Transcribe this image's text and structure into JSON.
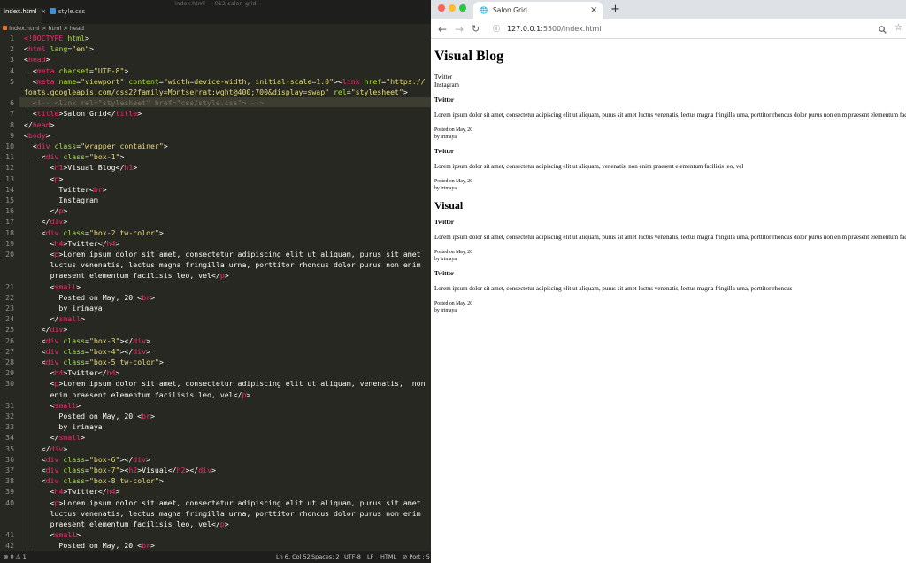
{
  "window_title": "index.html — 012-salon-grid",
  "editor": {
    "tabs": [
      {
        "label": "index.html",
        "close": "×"
      },
      {
        "label": "style.css"
      }
    ],
    "breadcrumb": {
      "file": "index.html",
      "sep": ">",
      "html": "html",
      "head": "head"
    },
    "lines": [
      {
        "n": "1",
        "h": "<span class=\"t\">&lt;!DOCTYPE</span> <span class=\"a\">html</span>&gt;"
      },
      {
        "n": "2",
        "h": "&lt;<span class=\"t\">html</span> <span class=\"a\">lang</span>=<span class=\"s\">\"en\"</span>&gt;"
      },
      {
        "n": "3",
        "h": "&lt;<span class=\"t\">head</span>&gt;"
      },
      {
        "n": "4",
        "h": "  &lt;<span class=\"t\">meta</span> <span class=\"a\">charset</span>=<span class=\"s\">\"UTF-8\"</span>&gt;"
      },
      {
        "n": "5",
        "h": "  &lt;<span class=\"t\">meta</span> <span class=\"a\">name</span>=<span class=\"s\">\"viewport\"</span> <span class=\"a\">content</span>=<span class=\"s\">\"width=device-width, initial-scale=1.0\"</span>&gt;&lt;<span class=\"t\">link</span> <span class=\"a\">href</span>=<span class=\"s\">\"https://</span>"
      },
      {
        "n": "",
        "h": "<span class=\"s\">fonts.googleapis.com/css2?family=Montserrat:wght@400;700&amp;display=swap\"</span> <span class=\"a\">rel</span>=<span class=\"s\">\"stylesheet\"</span>&gt;"
      },
      {
        "n": "6",
        "h": "  <span class=\"c\">&lt;!-- &lt;link rel=\"stylesheet\" href=\"css/style.css\"&gt; --&gt;</span>",
        "cur": true
      },
      {
        "n": "7",
        "h": "  &lt;<span class=\"t\">title</span>&gt;Salon Grid&lt;/<span class=\"t\">title</span>&gt;"
      },
      {
        "n": "8",
        "h": "&lt;/<span class=\"t\">head</span>&gt;"
      },
      {
        "n": "9",
        "h": "&lt;<span class=\"t\">body</span>&gt;"
      },
      {
        "n": "10",
        "h": "  &lt;<span class=\"t\">div</span> <span class=\"a\">class</span>=<span class=\"s\">\"wrapper container\"</span>&gt;"
      },
      {
        "n": "11",
        "h": "    &lt;<span class=\"t\">div</span> <span class=\"a\">class</span>=<span class=\"s\">\"box-1\"</span>&gt;"
      },
      {
        "n": "12",
        "h": "      &lt;<span class=\"t\">h1</span>&gt;Visual Blog&lt;/<span class=\"t\">h1</span>&gt;"
      },
      {
        "n": "13",
        "h": "      &lt;<span class=\"t\">p</span>&gt;"
      },
      {
        "n": "14",
        "h": "        Twitter&lt;<span class=\"t\">br</span>&gt;"
      },
      {
        "n": "15",
        "h": "        Instagram"
      },
      {
        "n": "16",
        "h": "      &lt;/<span class=\"t\">p</span>&gt;"
      },
      {
        "n": "17",
        "h": "    &lt;/<span class=\"t\">div</span>&gt;"
      },
      {
        "n": "18",
        "h": "    &lt;<span class=\"t\">div</span> <span class=\"a\">class</span>=<span class=\"s\">\"box-2 tw-color\"</span>&gt;"
      },
      {
        "n": "19",
        "h": "      &lt;<span class=\"t\">h4</span>&gt;Twitter&lt;/<span class=\"t\">h4</span>&gt;"
      },
      {
        "n": "20",
        "h": "      &lt;<span class=\"t\">p</span>&gt;Lorem ipsum dolor sit amet, consectetur adipiscing elit ut aliquam, purus sit amet"
      },
      {
        "n": "",
        "h": "      luctus venenatis, lectus magna fringilla urna, porttitor rhoncus dolor purus non enim"
      },
      {
        "n": "",
        "h": "      praesent elementum facilisis leo, vel&lt;/<span class=\"t\">p</span>&gt;"
      },
      {
        "n": "21",
        "h": "      &lt;<span class=\"t\">small</span>&gt;"
      },
      {
        "n": "22",
        "h": "        Posted on May, 20 &lt;<span class=\"t\">br</span>&gt;"
      },
      {
        "n": "23",
        "h": "        by irimaya"
      },
      {
        "n": "24",
        "h": "      &lt;/<span class=\"t\">small</span>&gt;"
      },
      {
        "n": "25",
        "h": "    &lt;/<span class=\"t\">div</span>&gt;"
      },
      {
        "n": "26",
        "h": "    &lt;<span class=\"t\">div</span> <span class=\"a\">class</span>=<span class=\"s\">\"box-3\"</span>&gt;&lt;/<span class=\"t\">div</span>&gt;"
      },
      {
        "n": "27",
        "h": "    &lt;<span class=\"t\">div</span> <span class=\"a\">class</span>=<span class=\"s\">\"box-4\"</span>&gt;&lt;/<span class=\"t\">div</span>&gt;"
      },
      {
        "n": "28",
        "h": "    &lt;<span class=\"t\">div</span> <span class=\"a\">class</span>=<span class=\"s\">\"box-5 tw-color\"</span>&gt;"
      },
      {
        "n": "29",
        "h": "      &lt;<span class=\"t\">h4</span>&gt;Twitter&lt;/<span class=\"t\">h4</span>&gt;"
      },
      {
        "n": "30",
        "h": "      &lt;<span class=\"t\">p</span>&gt;Lorem ipsum dolor sit amet, consectetur adipiscing elit ut aliquam, venenatis,  non"
      },
      {
        "n": "",
        "h": "      enim praesent elementum facilisis leo, vel&lt;/<span class=\"t\">p</span>&gt;"
      },
      {
        "n": "31",
        "h": "      &lt;<span class=\"t\">small</span>&gt;"
      },
      {
        "n": "32",
        "h": "        Posted on May, 20 &lt;<span class=\"t\">br</span>&gt;"
      },
      {
        "n": "33",
        "h": "        by irimaya"
      },
      {
        "n": "34",
        "h": "      &lt;/<span class=\"t\">small</span>&gt;"
      },
      {
        "n": "35",
        "h": "    &lt;/<span class=\"t\">div</span>&gt;"
      },
      {
        "n": "36",
        "h": "    &lt;<span class=\"t\">div</span> <span class=\"a\">class</span>=<span class=\"s\">\"box-6\"</span>&gt;&lt;/<span class=\"t\">div</span>&gt;"
      },
      {
        "n": "37",
        "h": "    &lt;<span class=\"t\">div</span> <span class=\"a\">class</span>=<span class=\"s\">\"box-7\"</span>&gt;&lt;<span class=\"t\">h2</span>&gt;Visual&lt;/<span class=\"t\">h2</span>&gt;&lt;/<span class=\"t\">div</span>&gt;"
      },
      {
        "n": "38",
        "h": "    &lt;<span class=\"t\">div</span> <span class=\"a\">class</span>=<span class=\"s\">\"box-8 tw-color\"</span>&gt;"
      },
      {
        "n": "39",
        "h": "      &lt;<span class=\"t\">h4</span>&gt;Twitter&lt;/<span class=\"t\">h4</span>&gt;"
      },
      {
        "n": "40",
        "h": "      &lt;<span class=\"t\">p</span>&gt;Lorem ipsum dolor sit amet, consectetur adipiscing elit ut aliquam, purus sit amet"
      },
      {
        "n": "",
        "h": "      luctus venenatis, lectus magna fringilla urna, porttitor rhoncus dolor purus non enim"
      },
      {
        "n": "",
        "h": "      praesent elementum facilisis leo, vel&lt;/<span class=\"t\">p</span>&gt;"
      },
      {
        "n": "41",
        "h": "      &lt;<span class=\"t\">small</span>&gt;"
      },
      {
        "n": "42",
        "h": "        Posted on May, 20 &lt;<span class=\"t\">br</span>&gt;"
      }
    ],
    "status": {
      "problems": "⊗ 0 ⚠ 1",
      "position": "Ln 6, Col 52",
      "spaces": "Spaces: 2",
      "encoding": "UTF-8",
      "eol": "LF",
      "language": "HTML",
      "port": "⊘ Port : 5"
    }
  },
  "browser": {
    "tab_title": "Salon Grid",
    "tab_close": "×",
    "new_tab": "+",
    "url_host": "127.0.0.1",
    "url_rest": ":5500/index.html",
    "page": {
      "h1": "Visual Blog",
      "social_1": "Twitter",
      "social_2": "Instagram",
      "h2": "Visual",
      "posts": [
        {
          "h4": "Twitter",
          "p": "Lorem ipsum dolor sit amet, consectetur adipiscing elit ut aliquam, purus sit amet luctus venenatis, lectus magna fringilla urna, porttitor rhoncus dolor purus non enim praesent elementum facilisis leo, vel",
          "date": "Posted on May, 20",
          "by": "by irimaya"
        },
        {
          "h4": "Twitter",
          "p": "Lorem ipsum dolor sit amet, consectetur adipiscing elit ut aliquam, venenatis, non enim praesent elementum facilisis leo, vel",
          "date": "Posted on May, 20",
          "by": "by irimaya"
        },
        {
          "h4": "Twitter",
          "p": "Lorem ipsum dolor sit amet, consectetur adipiscing elit ut aliquam, purus sit amet luctus venenatis, lectus magna fringilla urna, porttitor rhoncus dolor purus non enim praesent elementum facilisis leo, vel",
          "date": "Posted on May, 20",
          "by": "by irimaya"
        },
        {
          "h4": "Twitter",
          "p": "Lorem ipsum dolor sit amet, consectetur adipiscing elit ut aliquam, purus sit amet luctus venenatis, lectus magna fringilla urna, porttitor rhoncus",
          "date": "Posted on May, 20",
          "by": "by irimaya"
        }
      ]
    }
  }
}
